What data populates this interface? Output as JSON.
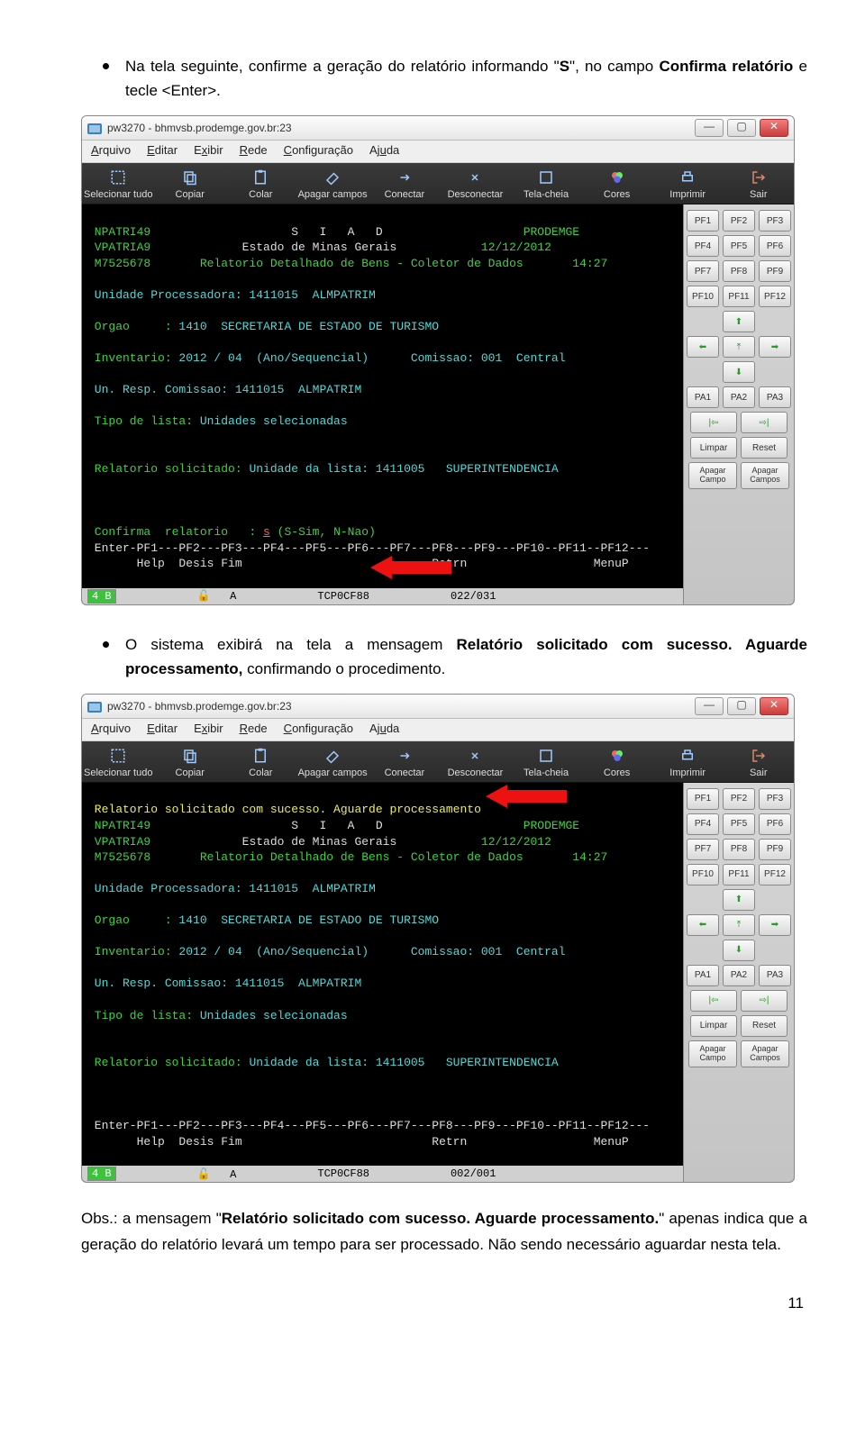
{
  "bullet1": {
    "pre": "Na tela seguinte, confirme a geração do relatório informando \"",
    "bold1": "S",
    "mid": "\", no campo ",
    "bold2": "Confirma relatório",
    "post": " e tecle <Enter>."
  },
  "bullet2": {
    "pre": "O sistema exibirá na tela a mensagem ",
    "bold1": "Relatório solicitado com sucesso. Aguarde processamento,",
    "post": " confirmando o procedimento."
  },
  "obs": {
    "pre": "Obs.: a mensagem \"",
    "bold": "Relatório solicitado com sucesso. Aguarde processamento.",
    "post": "\" apenas indica que a geração do relatório levará um tempo para ser processado. Não sendo necessário aguardar nesta tela."
  },
  "pagenum": "11",
  "window": {
    "title": "pw3270 - bhmvsb.prodemge.gov.br:23",
    "menu": [
      "Arquivo",
      "Editar",
      "Exibir",
      "Rede",
      "Configuração",
      "Ajuda"
    ],
    "toolbar": [
      "Selecionar tudo",
      "Copiar",
      "Colar",
      "Apagar campos",
      "Conectar",
      "Desconectar",
      "Tela-cheia",
      "Cores",
      "Imprimir",
      "Sair"
    ],
    "keypad": {
      "pf_rows": [
        [
          "PF1",
          "PF2",
          "PF3"
        ],
        [
          "PF4",
          "PF5",
          "PF6"
        ],
        [
          "PF7",
          "PF8",
          "PF9"
        ],
        [
          "PF10",
          "PF11",
          "PF12"
        ]
      ],
      "pa_row": [
        "PA1",
        "PA2",
        "PA3"
      ],
      "wide_rows": [
        [
          "Limpar",
          "Reset"
        ]
      ],
      "wide2": [
        "Apagar Campo",
        "Apagar Campos"
      ]
    }
  },
  "term1": {
    "l1a": " NPATRI49                    ",
    "l1b": "S   I   A   D",
    "l1c": "                    PRODEMGE",
    "l2a": " VPATRIA9             ",
    "l2b": "Estado de Minas Gerais",
    "l2c": "            12/12/2012",
    "l3": " M7525678       Relatorio Detalhado de Bens - Coletor de Dados       14:27",
    "l5": " Unidade Processadora: 1411015  ALMPATRIM",
    "l7a": " Orgao     :",
    "l7b": " 1410  SECRETARIA DE ESTADO DE TURISMO",
    "l9a": " Inventario:",
    "l9b": " 2012 / 04  (Ano/Sequencial)      Comissao: 001  Central",
    "l11": " Un. Resp. Comissao: 1411015  ALMPATRIM",
    "l13a": " Tipo de lista:",
    "l13b": " Unidades selecionadas",
    "l16a": " Relatorio solicitado:",
    "l16b": " Unidade da lista: 1411005   SUPERINTENDENCIA",
    "l20a": " Confirma  relatorio   : ",
    "l20b": "s",
    "l20c": " (S-Sim, N-Nao)",
    "l21": " Enter-PF1---PF2---PF3---PF4---PF5---PF6---PF7---PF8---PF9---PF10--PF11--PF12---",
    "l22": "       Help  Desis Fim                           Retrn                  MenuP",
    "status_box": "4 B",
    "status_lock": "🔓",
    "status_a": "A",
    "status_host": "TCP0CF88",
    "status_pos": "022/031"
  },
  "term2": {
    "l0": " Relatorio solicitado com sucesso. Aguarde processamento",
    "l1a": " NPATRI49                    ",
    "l1b": "S   I   A   D",
    "l1c": "                    PRODEMGE",
    "l2a": " VPATRIA9             ",
    "l2b": "Estado de Minas Gerais",
    "l2c": "            12/12/2012",
    "l3": " M7525678       Relatorio Detalhado de Bens - Coletor de Dados       14:27",
    "l5": " Unidade Processadora: 1411015  ALMPATRIM",
    "l7a": " Orgao     :",
    "l7b": " 1410  SECRETARIA DE ESTADO DE TURISMO",
    "l9a": " Inventario:",
    "l9b": " 2012 / 04  (Ano/Sequencial)      Comissao: 001  Central",
    "l11": " Un. Resp. Comissao: 1411015  ALMPATRIM",
    "l13a": " Tipo de lista:",
    "l13b": " Unidades selecionadas",
    "l16a": " Relatorio solicitado:",
    "l16b": " Unidade da lista: 1411005   SUPERINTENDENCIA",
    "l21": " Enter-PF1---PF2---PF3---PF4---PF5---PF6---PF7---PF8---PF9---PF10--PF11--PF12---",
    "l22": "       Help  Desis Fim                           Retrn                  MenuP",
    "status_box": "4 B",
    "status_lock": "🔓",
    "status_a": "A",
    "status_host": "TCP0CF88",
    "status_pos": "002/001"
  }
}
